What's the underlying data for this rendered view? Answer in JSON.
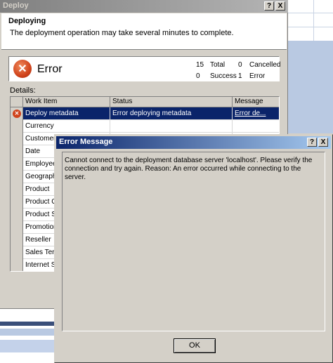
{
  "deploy_window": {
    "title": "Deploy",
    "help_button": "?",
    "close_button": "X",
    "header_title": "Deploying",
    "header_subtitle": "The deployment operation may take several minutes to complete.",
    "status": {
      "label": "Error",
      "total_count": "15",
      "total_label": "Total",
      "cancelled_count": "0",
      "cancelled_label": "Cancelled",
      "success_count": "0",
      "success_label": "Success",
      "error_count": "1",
      "error_label": "Error"
    },
    "details_label": "Details:",
    "grid": {
      "columns": [
        "Work Item",
        "Status",
        "Message"
      ],
      "rows": [
        {
          "work_item": "Deploy metadata",
          "status": "Error deploying metadata",
          "message": "Error de..."
        },
        {
          "work_item": "Currency",
          "status": "",
          "message": ""
        },
        {
          "work_item": "Customer",
          "status": "",
          "message": ""
        },
        {
          "work_item": "Date",
          "status": "",
          "message": ""
        },
        {
          "work_item": "Employee",
          "status": "",
          "message": ""
        },
        {
          "work_item": "Geograph",
          "status": "",
          "message": ""
        },
        {
          "work_item": "Product",
          "status": "",
          "message": ""
        },
        {
          "work_item": "Product C",
          "status": "",
          "message": ""
        },
        {
          "work_item": "Product S",
          "status": "",
          "message": ""
        },
        {
          "work_item": "Promotion",
          "status": "",
          "message": ""
        },
        {
          "work_item": "Reseller",
          "status": "",
          "message": ""
        },
        {
          "work_item": "Sales Terr",
          "status": "",
          "message": ""
        },
        {
          "work_item": "Internet S",
          "status": "",
          "message": ""
        }
      ]
    }
  },
  "error_dialog": {
    "title": "Error Message",
    "help_button": "?",
    "close_button": "X",
    "message": "Cannot connect to the deployment database server 'localhost'. Please verify the connection and try again. Reason: An error occurred while connecting to the server.",
    "ok_label": "OK"
  },
  "colors": {
    "selection": "#0a246a",
    "error_icon": "#d0431b",
    "active_title": "#0a246a",
    "inactive_title": "#808080"
  }
}
